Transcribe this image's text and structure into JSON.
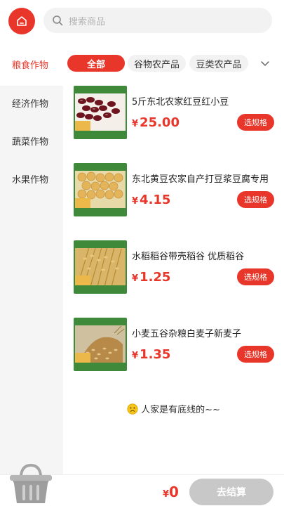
{
  "header": {
    "search_placeholder": "搜索商品"
  },
  "sidebar": {
    "items": [
      {
        "label": "粮食作物",
        "active": true
      },
      {
        "label": "经济作物",
        "active": false
      },
      {
        "label": "蔬菜作物",
        "active": false
      },
      {
        "label": "水果作物",
        "active": false
      }
    ]
  },
  "subtabs": {
    "items": [
      {
        "label": "全部",
        "active": true
      },
      {
        "label": "谷物农产品",
        "active": false
      },
      {
        "label": "豆类农产品",
        "active": false
      }
    ],
    "more_icon": "chevron-down-icon"
  },
  "products": [
    {
      "name": "5斤东北农家红豆红小豆",
      "currency": "¥",
      "price": "25.00",
      "spec_label": "选规格",
      "image": "red-beans"
    },
    {
      "name": "东北黄豆农家自产打豆浆豆腐专用",
      "currency": "¥",
      "price": "4.15",
      "spec_label": "选规格",
      "image": "soybeans"
    },
    {
      "name": "水稻稻谷带壳稻谷 优质稻谷",
      "currency": "¥",
      "price": "1.25",
      "spec_label": "选规格",
      "image": "rice-paddy"
    },
    {
      "name": "小麦五谷杂粮白麦子新麦子",
      "currency": "¥",
      "price": "1.35",
      "spec_label": "选规格",
      "image": "wheat"
    }
  ],
  "end_text": "人家是有底线的~~",
  "bottom": {
    "currency": "¥",
    "total": "0",
    "checkout_label": "去结算"
  },
  "colors": {
    "accent": "#e8372a",
    "sidebar_bg": "#f5f5f5",
    "checkout_disabled": "#c8c8c8",
    "thumb_frame": "#3f8a3a"
  }
}
